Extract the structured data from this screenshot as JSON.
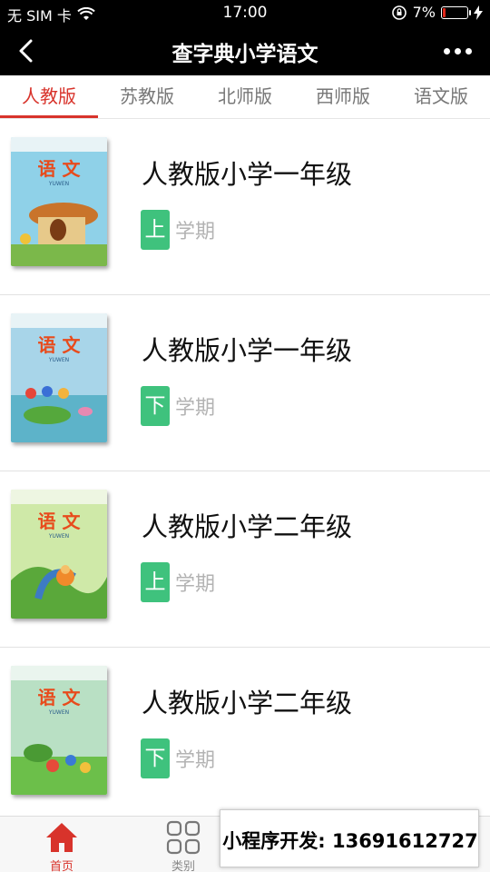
{
  "status_bar": {
    "carrier": "无 SIM 卡",
    "time": "17:00",
    "battery_percent": "7%",
    "battery_level": 0.07
  },
  "nav": {
    "title": "查字典小学语文"
  },
  "tabs": [
    {
      "label": "人教版",
      "active": true
    },
    {
      "label": "苏教版",
      "active": false
    },
    {
      "label": "北师版",
      "active": false
    },
    {
      "label": "西师版",
      "active": false
    },
    {
      "label": "语文版",
      "active": false
    }
  ],
  "books": [
    {
      "title": "人教版小学一年级",
      "term_badge": "上",
      "term_text": "学期"
    },
    {
      "title": "人教版小学一年级",
      "term_badge": "下",
      "term_text": "学期"
    },
    {
      "title": "人教版小学二年级",
      "term_badge": "上",
      "term_text": "学期"
    },
    {
      "title": "人教版小学二年级",
      "term_badge": "下",
      "term_text": "学期"
    }
  ],
  "cover": {
    "logo_text": "语 文",
    "pinyin": "YUWEN"
  },
  "bottom_nav": [
    {
      "label": "首页",
      "icon": "home-icon",
      "active": true
    },
    {
      "label": "类别",
      "icon": "category-grid-icon",
      "active": false
    }
  ],
  "promo": {
    "text": "小程序开发:  13691612727"
  },
  "colors": {
    "accent_red": "#d8332b",
    "badge_green": "#3fc27d",
    "header_black": "#000000"
  }
}
